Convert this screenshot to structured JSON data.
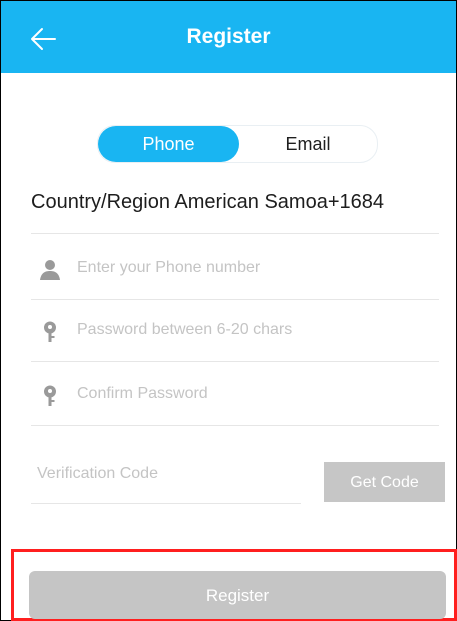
{
  "header": {
    "title": "Register",
    "back_icon": "back-arrow-icon"
  },
  "toggle": {
    "phone_label": "Phone",
    "email_label": "Email",
    "selected": "Phone"
  },
  "country": {
    "text": "Country/Region American Samoa+1684"
  },
  "fields": {
    "phone_placeholder": "Enter your Phone number",
    "password_placeholder": "Password between 6-20 chars",
    "confirm_placeholder": "Confirm Password",
    "verification_placeholder": "Verification Code"
  },
  "buttons": {
    "get_code": "Get Code",
    "register": "Register"
  },
  "colors": {
    "brand": "#19b5f2",
    "disabled": "#c5c5c5",
    "highlight": "#ff1f1f"
  }
}
